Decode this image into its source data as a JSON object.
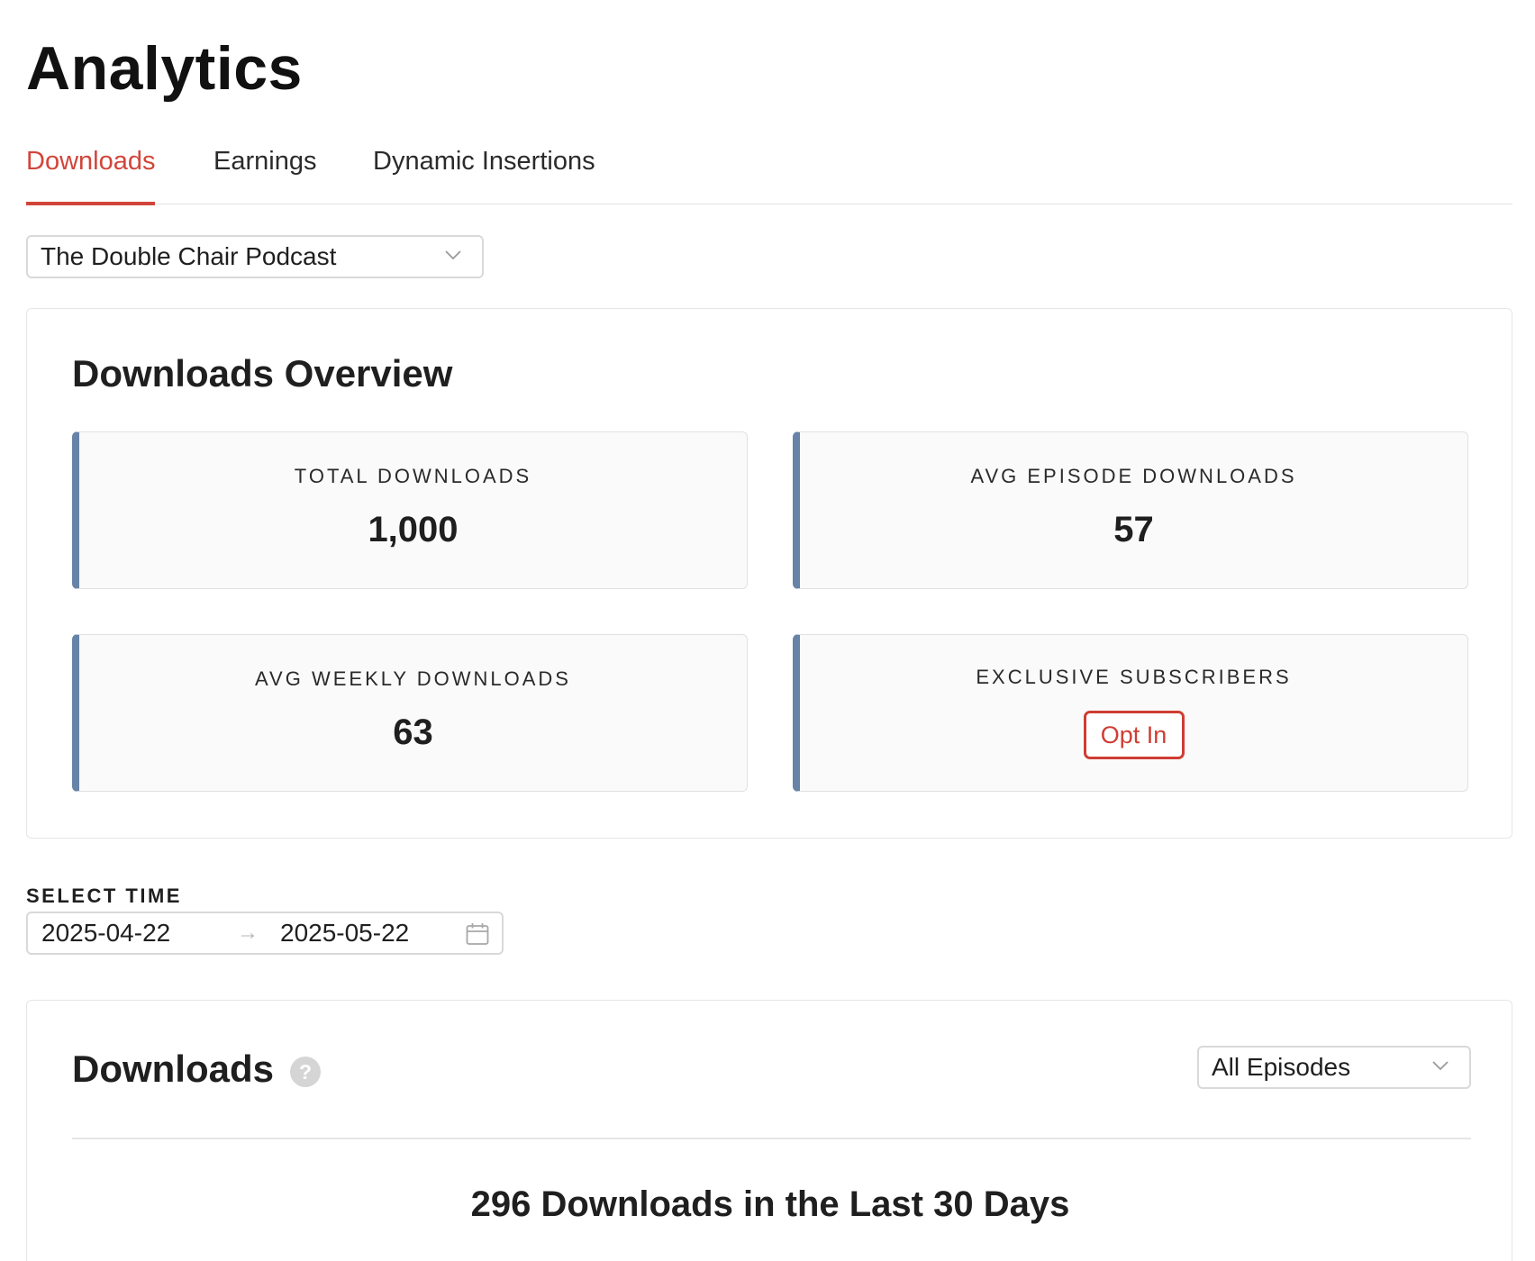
{
  "page": {
    "title": "Analytics"
  },
  "tabs": [
    {
      "label": "Downloads",
      "active": true
    },
    {
      "label": "Earnings",
      "active": false
    },
    {
      "label": "Dynamic Insertions",
      "active": false
    }
  ],
  "podcast_select": {
    "value": "The Double Chair Podcast"
  },
  "overview": {
    "title": "Downloads Overview",
    "stats": {
      "total": {
        "label": "TOTAL DOWNLOADS",
        "value": "1,000"
      },
      "avg_episode": {
        "label": "AVG EPISODE DOWNLOADS",
        "value": "57"
      },
      "avg_weekly": {
        "label": "AVG WEEKLY DOWNLOADS",
        "value": "63"
      },
      "exclusive": {
        "label": "EXCLUSIVE SUBSCRIBERS",
        "button_label": "Opt In"
      }
    }
  },
  "select_time": {
    "label": "SELECT TIME",
    "start_date": "2025-04-22",
    "separator": "→",
    "end_date": "2025-05-22"
  },
  "downloads_section": {
    "title": "Downloads",
    "help_glyph": "?",
    "episode_filter": "All Episodes",
    "summary": "296 Downloads in the Last 30 Days"
  },
  "colors": {
    "accent": "#d2453a",
    "stat_border": "#6783a8",
    "stat_background": "#fafafa"
  },
  "icons": {
    "chevron": "chevron-down-icon",
    "calendar": "calendar-icon",
    "help": "help-icon"
  }
}
